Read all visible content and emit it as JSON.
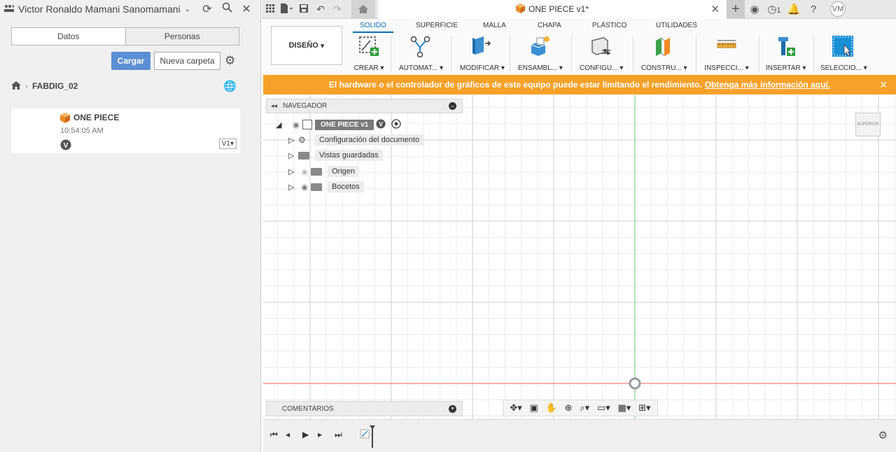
{
  "left_panel": {
    "user_name": "Victor Ronaldo Mamani Sanomamani",
    "tabs": [
      {
        "label": "Datos"
      },
      {
        "label": "Personas"
      }
    ],
    "upload_label": "Cargar",
    "new_folder_label": "Nueva carpeta",
    "breadcrumb": "FABDIG_02",
    "file": {
      "name": "ONE PIECE",
      "time": "10:54:05 AM",
      "version_badge": "V",
      "version_select": "V1"
    }
  },
  "topbar": {
    "doc_title": "ONE PIECE v1*",
    "jobs_count": "1",
    "avatar": "VM"
  },
  "ribbon": {
    "workspace": "DISEÑO",
    "tabs": [
      "SOLIDO",
      "SUPERFICIE",
      "MALLA",
      "CHAPA",
      "PLÁSTICO",
      "UTILIDADES"
    ],
    "tools": [
      "CREAR",
      "AUTOMAT...",
      "MODIFICAR",
      "ENSAMBL...",
      "CONFIGU...",
      "CONSTRU...",
      "INSPECCI...",
      "INSERTAR",
      "SELECCIO..."
    ]
  },
  "warning": {
    "text": "El hardware o el controlador de gráficos de este equipo puede estar limitando el rendimiento.",
    "link": "Obtenga más información aquí."
  },
  "browser": {
    "title": "NAVEGADOR",
    "root": "ONE PIECE v1",
    "root_badge": "V",
    "items": [
      "Configuración del documento",
      "Vistas guardadas",
      "Origen",
      "Bocetos"
    ]
  },
  "viewcube": {
    "face": "SUPERIOR"
  },
  "comments": {
    "title": "COMENTARIOS"
  },
  "colors": {
    "accent": "#0b6fb5",
    "warning": "#f7a12a",
    "primary_button": "#5b8fd4",
    "x_axis": "#f08080",
    "y_axis": "#7ed67e"
  }
}
